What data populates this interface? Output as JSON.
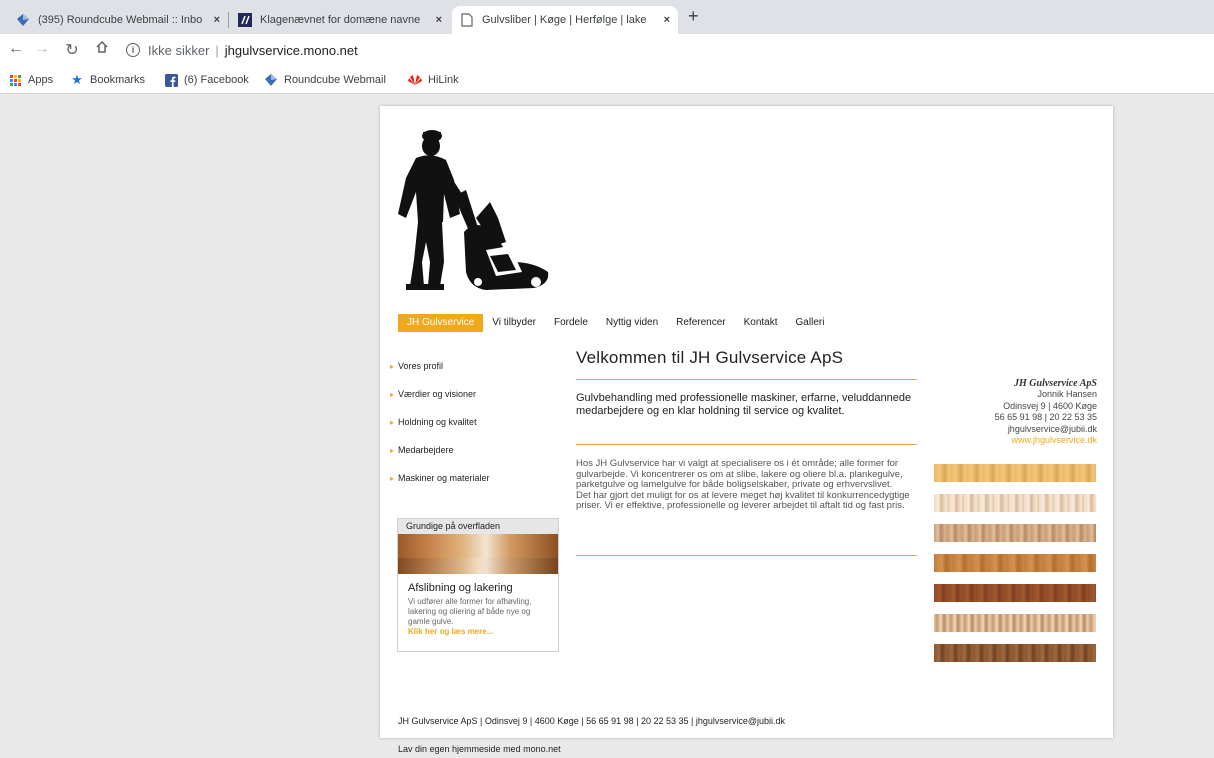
{
  "browser": {
    "tabs": [
      {
        "title": "(395) Roundcube Webmail :: Inbo",
        "icon": "roundcube-icon"
      },
      {
        "title": "Klagenævnet for domæne navne",
        "icon": "klagenaevnet-icon"
      },
      {
        "title": "Gulvsliber | Køge | Herfølge | lake",
        "icon": "page-icon"
      }
    ],
    "new_tab": "+",
    "close": "×",
    "insecure_label": "Ikke sikker",
    "separator": "|",
    "url": "jhgulvservice.mono.net",
    "bookmarks": [
      {
        "label": "Apps",
        "icon": "apps-grid-icon"
      },
      {
        "label": "Bookmarks",
        "icon": "star-icon"
      },
      {
        "label": "(6) Facebook",
        "icon": "facebook-icon"
      },
      {
        "label": "Roundcube Webmail",
        "icon": "roundcube-icon"
      },
      {
        "label": "HiLink",
        "icon": "huawei-icon"
      }
    ]
  },
  "site": {
    "menu": [
      "JH Gulvservice",
      "Vi tilbyder",
      "Fordele",
      "Nyttig viden",
      "Referencer",
      "Kontakt",
      "Galleri"
    ],
    "active_menu": "JH Gulvservice",
    "sidebar": [
      "Vores profil",
      "Værdier og visioner",
      "Holdning og kvalitet",
      "Medarbejdere",
      "Maskiner og materialer"
    ],
    "promo": {
      "header": "Grundige på overfladen",
      "title": "Afslibning og lakering",
      "text": "Vi udfører alle former for afhøvling, lakering og oliering af både nye og gamle gulve.",
      "link": "Klik her og læs mere..."
    },
    "heading": "Velkommen til JH Gulvservice ApS",
    "lead": "Gulvbehandling med professionelle maskiner, erfarne, veluddannede medarbejdere og en klar holdning til service og kvalitet.",
    "body": [
      "Hos JH Gulvservice har vi valgt at specialisere os i ét område; alle former for gulvarbejde. Vi koncentrerer os om at slibe, lakere og oliere bl.a. plankegulve, parketgulve og lamelgulve for både boligselskaber, private og erhvervslivet.",
      "Det har gjort det muligt for os at levere meget høj kvalitet til konkurrencedygtige priser. Vi er effektive, professionelle og leverer arbejdet til aftalt tid og fast pris."
    ],
    "contact": {
      "company": "JH Gulvservice ApS",
      "person": "Jonnik Hansen",
      "address": "Odinsvej 9 | 4600 Køge",
      "phones": "56 65 91 98 | 20 22 53 35",
      "email": "jhgulvservice@jubii.dk",
      "web": "www.jhgulvservice.dk"
    },
    "footer": "JH Gulvservice ApS | Odinsvej 9 | 4600 Køge | 56 65 91 98 | 20 22 53 35 | jhgulvservice@jubii.dk",
    "below_footer": "Lav din egen hjemmeside med mono.net"
  },
  "colors": {
    "accent": "#f2a81d",
    "page_bg": "#e9e9e9",
    "tabbar": "#dee1e6"
  }
}
